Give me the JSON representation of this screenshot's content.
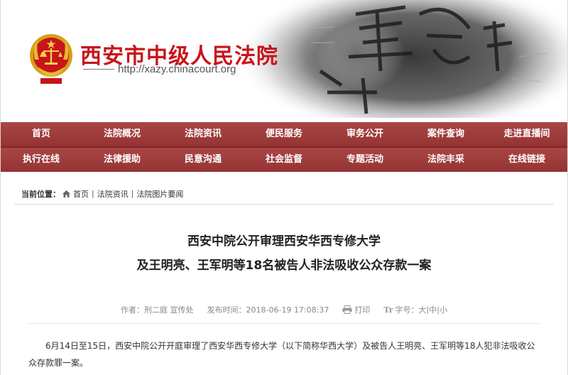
{
  "header": {
    "title": "西安市中级人民法院",
    "url": "http://xazy.chinacourt.org"
  },
  "nav": {
    "row1": [
      "首页",
      "法院概况",
      "法院资讯",
      "便民服务",
      "审务公开",
      "案件查询",
      "走进直播间"
    ],
    "row2": [
      "执行在线",
      "法律援助",
      "民意沟通",
      "社会监督",
      "专题活动",
      "法院丰采",
      "在线链接"
    ]
  },
  "breadcrumb": {
    "label": "当前位置：",
    "items": [
      "首页",
      "法院资讯",
      "法院图片要闻"
    ],
    "separator": "|"
  },
  "article": {
    "title_line1": "西安中院公开审理西安华西专修大学",
    "title_line2": "及王明亮、王军明等18名被告人非法吸收公众存款一案",
    "meta": {
      "author": "作者：刑二庭 宣传处",
      "publish_time": "发布时间：2018-06-19 17:08:37",
      "print_label": "打印",
      "font_size_label": "字号：",
      "size_large": "大",
      "size_medium": "中",
      "size_small": "小",
      "size_sep": "|"
    },
    "paragraph": "6月14日至15日，西安中院公开开庭审理了西安华西专修大学（以下简称华西大学）及被告人王明亮、王军明等18人犯非法吸收公众存款罪一案。"
  },
  "icons": {
    "emblem": "court-emblem-icon",
    "home": "home-icon",
    "print": "print-icon",
    "font_size": "font-size-icon"
  },
  "colors": {
    "brand_red": "#c8141b",
    "nav_bg": "#9b3a3a"
  }
}
